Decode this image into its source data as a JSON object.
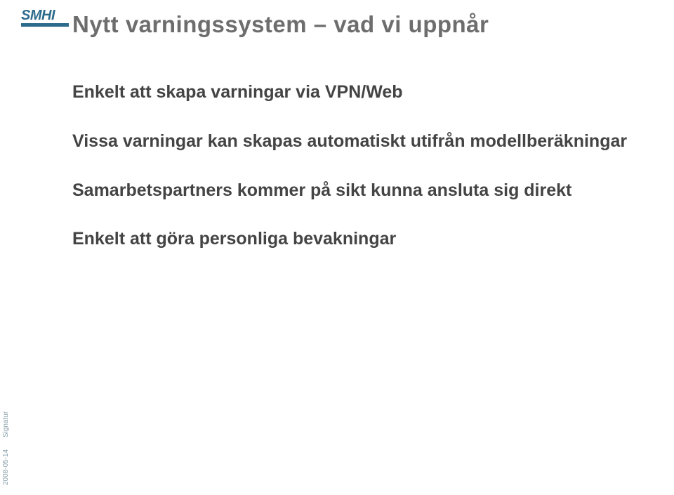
{
  "logo": {
    "text": "SMHI"
  },
  "title": "Nytt varningssystem – vad vi uppnår",
  "bullets": [
    "Enkelt att skapa varningar via VPN/Web",
    "Vissa varningar kan skapas automatiskt utifrån modellberäkningar",
    "Samarbetspartners kommer på sikt kunna ansluta sig direkt",
    "Enkelt att göra personliga bevakningar"
  ],
  "footer": {
    "date": "2008-05-14",
    "signatur": "Signatur"
  }
}
